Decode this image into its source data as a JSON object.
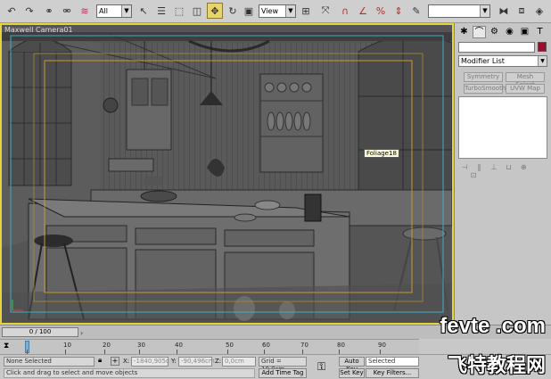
{
  "toolbar": {
    "selection_filter": "All",
    "reference_coord": "View",
    "named_selection": "",
    "icons": [
      "undo-icon",
      "redo-icon",
      "select-link-icon",
      "unlink-icon",
      "bind-spacewarp-icon",
      "select-object-icon",
      "select-by-name-icon",
      "rect-selection-icon",
      "window-crossing-icon",
      "select-move-icon",
      "select-rotate-icon",
      "select-scale-icon",
      "use-pivot-icon",
      "select-manipulate-icon",
      "snap-toggle-icon",
      "angle-snap-icon",
      "percent-snap-icon",
      "spinner-snap-icon",
      "edit-named-sel-icon",
      "mirror-icon",
      "align-icon"
    ]
  },
  "viewport": {
    "label": "Maxwell Camera01",
    "tooltip": "Foliage18",
    "border_color": "#e6d43a"
  },
  "command_panel": {
    "tabs": [
      "create-tab",
      "modify-tab",
      "hierarchy-tab",
      "motion-tab",
      "display-tab",
      "utilities-tab"
    ],
    "object_color": "#9a1030",
    "modifier_list": "Modifier List",
    "buttons": [
      "Symmetry",
      "Mesh Select",
      "TurboSmooth",
      "UVW Map"
    ]
  },
  "timeline": {
    "frame_display": "0 / 100",
    "ticks": [
      "0",
      "10",
      "20",
      "30",
      "40",
      "50",
      "60",
      "70",
      "80",
      "90"
    ]
  },
  "status": {
    "selection": "None Selected",
    "prompt": "Click and drag to select and move objects",
    "x_label": "X:",
    "x_value": "-1840,905c",
    "y_label": "Y:",
    "y_value": "-90,496cm",
    "z_label": "Z:",
    "z_value": "0,0cm",
    "grid": "Grid = 10,0cm",
    "add_time_tag": "Add Time Tag",
    "auto_key": "Auto Key",
    "set_key": "Set Key",
    "key_mode": "Selected",
    "key_filters": "Key Filters..."
  },
  "watermark": {
    "line1": "fevte .com",
    "line2": "飞特教程网"
  }
}
